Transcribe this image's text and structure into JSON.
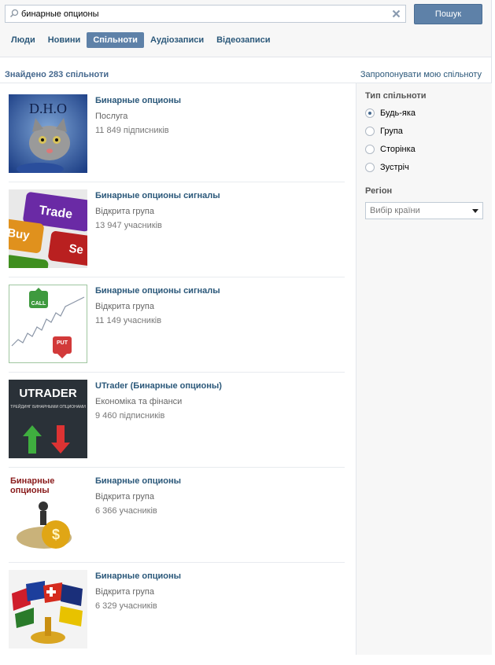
{
  "search": {
    "value": "бинарные опционы",
    "button_label": "Пошук"
  },
  "tabs": [
    {
      "label": "Люди",
      "active": false
    },
    {
      "label": "Новини",
      "active": false
    },
    {
      "label": "Спільноти",
      "active": true
    },
    {
      "label": "Аудіозаписи",
      "active": false
    },
    {
      "label": "Відеозаписи",
      "active": false
    }
  ],
  "summary": {
    "found_text": "Знайдено 283 спільноти",
    "suggest_link": "Запропонувати мою спільноту"
  },
  "results": [
    {
      "name": "Бинарные опционы",
      "type": "Послуга",
      "members": "11 849 підписників",
      "thumb_text": "D.H.O"
    },
    {
      "name": "Бинарные опционы сигналы",
      "type": "Відкрита група",
      "members": "13 947 учасників",
      "thumb_text": "Trade",
      "thumb_text2": "Buy",
      "thumb_text3": "Se"
    },
    {
      "name": "Бинарные опционы сигналы",
      "type": "Відкрита група",
      "members": "11 149 учасників",
      "thumb_text": "CALL",
      "thumb_text2": "PUT"
    },
    {
      "name": "UTrader (Бинарные опционы)",
      "type": "Економіка та фінанси",
      "members": "9 460 підписників",
      "thumb_text": "UTRADER",
      "thumb_text2": "ТРЕЙДИНГ БИНАРНЫМИ ОПЦИОНАМИ"
    },
    {
      "name": "Бинарные опционы",
      "type": "Відкрита група",
      "members": "6 366 учасників",
      "thumb_text": "Бинарные опционы"
    },
    {
      "name": "Бинарные опционы",
      "type": "Відкрита група",
      "members": "6 329 учасників"
    }
  ],
  "sidebar": {
    "type_title": "Тип спільноти",
    "type_options": [
      {
        "label": "Будь-яка",
        "checked": true
      },
      {
        "label": "Група",
        "checked": false
      },
      {
        "label": "Сторінка",
        "checked": false
      },
      {
        "label": "Зустріч",
        "checked": false
      }
    ],
    "region_title": "Регіон",
    "country_select": "Вибір країни"
  },
  "colors": {
    "accent": "#5e81a8",
    "link": "#2b587a"
  }
}
